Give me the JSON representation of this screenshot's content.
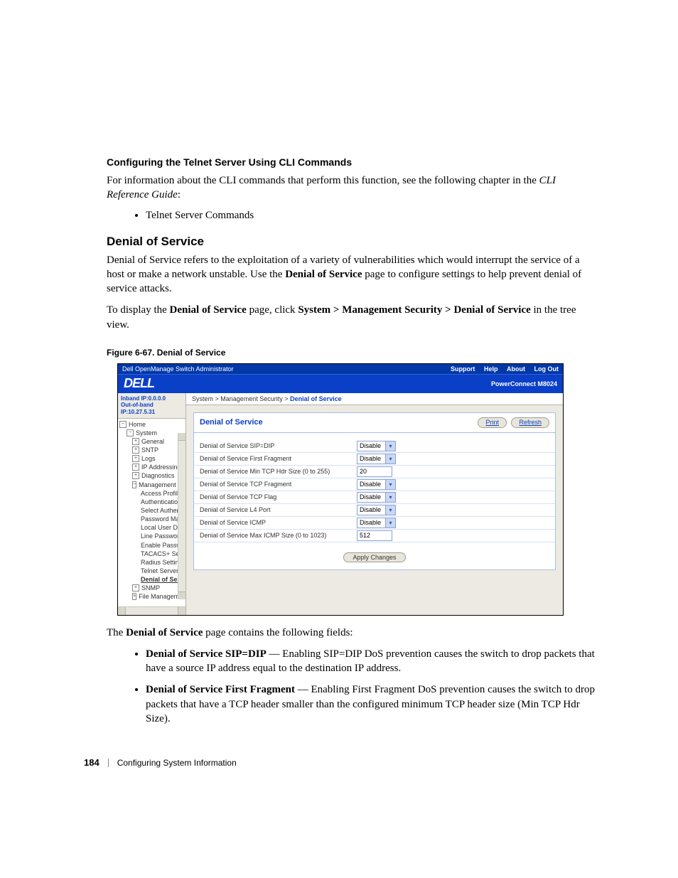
{
  "subheading": "Configuring the Telnet Server Using CLI Commands",
  "para1_a": "For information about the CLI commands that perform this function, see the following chapter in the ",
  "para1_b": "CLI Reference Guide",
  "para1_c": ":",
  "bullet1": "Telnet Server Commands",
  "section_title": "Denial of Service",
  "dos_para1_a": "Denial of Service refers to the exploitation of a variety of vulnerabilities which would interrupt the service of a host or make a network unstable. Use the ",
  "dos_para1_b": "Denial of Service",
  "dos_para1_c": " page to configure settings to help prevent denial of service attacks.",
  "dos_para2_a": "To display the ",
  "dos_para2_b": "Denial of Service",
  "dos_para2_c": " page, click ",
  "dos_para2_d": "System > Management Security > Denial of Service",
  "dos_para2_e": " in the tree view.",
  "figure_label": "Figure 6-67.    Denial of Service",
  "ss": {
    "titlebar_title": "Dell OpenManage Switch Administrator",
    "titlebar_links": [
      "Support",
      "Help",
      "About",
      "Log Out"
    ],
    "logo": "DELL",
    "model": "PowerConnect M8024",
    "ip_inband": "Inband IP:0.0.0.0",
    "ip_outband": "Out-of-band IP:10.27.5.31",
    "tree": {
      "home": "Home",
      "system": "System",
      "general": "General",
      "sntp": "SNTP",
      "logs": "Logs",
      "ipaddr": "IP Addressing",
      "diag": "Diagnostics",
      "mgmt": "Management Secur",
      "children": [
        "Access Profiles",
        "Authentication P",
        "Select Authentic",
        "Password Manag",
        "Local User Datal",
        "Line Password",
        "Enable Passwor",
        "TACACS+ Settin",
        "Radius Settings",
        "Telnet Server"
      ],
      "selected": "Denial of Servi",
      "snmp": "SNMP",
      "filemgmt": "File Management"
    },
    "crumb_a": "System > Management Security > ",
    "crumb_b": "Denial of Service",
    "panel_title": "Denial of Service",
    "btn_print": "Print",
    "btn_refresh": "Refresh",
    "rows": [
      {
        "label": "Denial of Service SIP=DIP",
        "type": "select",
        "value": "Disable"
      },
      {
        "label": "Denial of Service First Fragment",
        "type": "select",
        "value": "Disable"
      },
      {
        "label": "Denial of Service Min TCP Hdr Size (0 to 255)",
        "type": "input",
        "value": "20"
      },
      {
        "label": "Denial of Service TCP Fragment",
        "type": "select",
        "value": "Disable"
      },
      {
        "label": "Denial of Service TCP Flag",
        "type": "select",
        "value": "Disable"
      },
      {
        "label": "Denial of Service L4 Port",
        "type": "select",
        "value": "Disable"
      },
      {
        "label": "Denial of Service ICMP",
        "type": "select",
        "value": "Disable"
      },
      {
        "label": "Denial of Service Max ICMP Size (0 to 1023)",
        "type": "input",
        "value": "512"
      }
    ],
    "apply": "Apply Changes"
  },
  "after_fig_intro_a": "The ",
  "after_fig_intro_b": "Denial of Service",
  "after_fig_intro_c": " page contains the following fields:",
  "desc": [
    {
      "bold": "Denial of Service SIP=DIP",
      "rest": " — Enabling SIP=DIP DoS prevention causes the switch to drop packets that have a source IP address equal to the destination IP address."
    },
    {
      "bold": "Denial of Service First Fragment",
      "rest": " — Enabling First Fragment DoS prevention causes the switch to drop packets that have a TCP header smaller than the configured minimum TCP header size (Min TCP Hdr Size)."
    }
  ],
  "footer_page": "184",
  "footer_text": "Configuring System Information"
}
